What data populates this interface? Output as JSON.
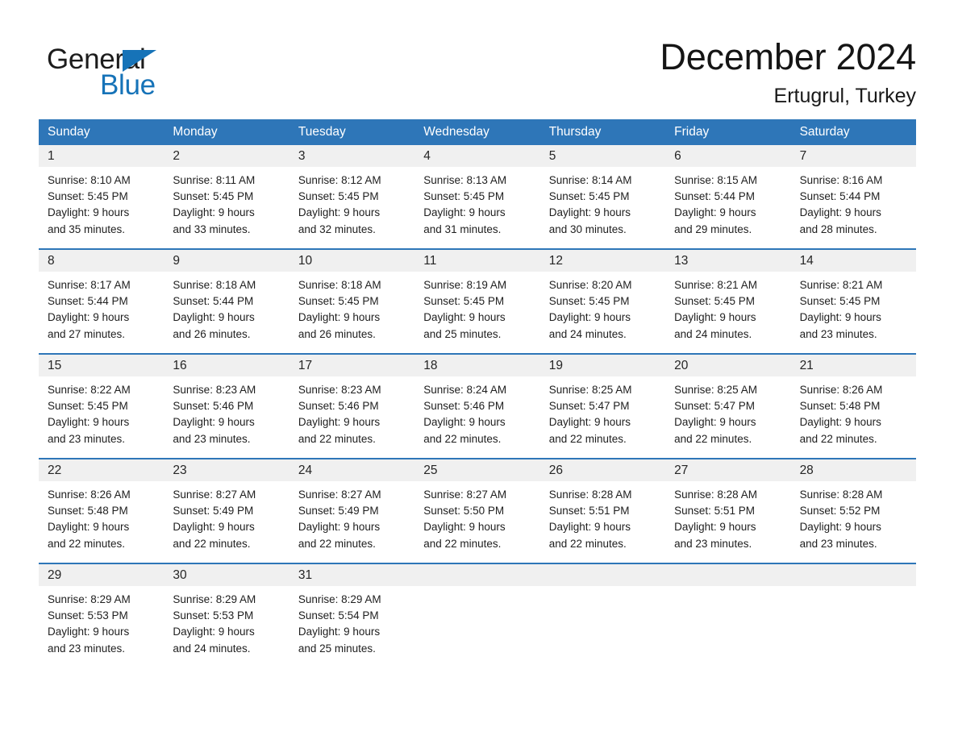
{
  "brand": {
    "word_one": "General",
    "word_two": "Blue",
    "triangle_icon": "triangle-icon",
    "accent_color": "#1673b8"
  },
  "header": {
    "month_title": "December 2024",
    "location": "Ertugrul, Turkey"
  },
  "theme": {
    "header_blue": "#2e76b8",
    "daynum_band": "#f0f0f0",
    "text": "#1e1e1e",
    "page_bg": "#ffffff"
  },
  "weekdays": [
    "Sunday",
    "Monday",
    "Tuesday",
    "Wednesday",
    "Thursday",
    "Friday",
    "Saturday"
  ],
  "weeks": [
    {
      "days": [
        {
          "num": "1",
          "sunrise": "Sunrise: 8:10 AM",
          "sunset": "Sunset: 5:45 PM",
          "daylight_l1": "Daylight: 9 hours",
          "daylight_l2": "and 35 minutes."
        },
        {
          "num": "2",
          "sunrise": "Sunrise: 8:11 AM",
          "sunset": "Sunset: 5:45 PM",
          "daylight_l1": "Daylight: 9 hours",
          "daylight_l2": "and 33 minutes."
        },
        {
          "num": "3",
          "sunrise": "Sunrise: 8:12 AM",
          "sunset": "Sunset: 5:45 PM",
          "daylight_l1": "Daylight: 9 hours",
          "daylight_l2": "and 32 minutes."
        },
        {
          "num": "4",
          "sunrise": "Sunrise: 8:13 AM",
          "sunset": "Sunset: 5:45 PM",
          "daylight_l1": "Daylight: 9 hours",
          "daylight_l2": "and 31 minutes."
        },
        {
          "num": "5",
          "sunrise": "Sunrise: 8:14 AM",
          "sunset": "Sunset: 5:45 PM",
          "daylight_l1": "Daylight: 9 hours",
          "daylight_l2": "and 30 minutes."
        },
        {
          "num": "6",
          "sunrise": "Sunrise: 8:15 AM",
          "sunset": "Sunset: 5:44 PM",
          "daylight_l1": "Daylight: 9 hours",
          "daylight_l2": "and 29 minutes."
        },
        {
          "num": "7",
          "sunrise": "Sunrise: 8:16 AM",
          "sunset": "Sunset: 5:44 PM",
          "daylight_l1": "Daylight: 9 hours",
          "daylight_l2": "and 28 minutes."
        }
      ]
    },
    {
      "days": [
        {
          "num": "8",
          "sunrise": "Sunrise: 8:17 AM",
          "sunset": "Sunset: 5:44 PM",
          "daylight_l1": "Daylight: 9 hours",
          "daylight_l2": "and 27 minutes."
        },
        {
          "num": "9",
          "sunrise": "Sunrise: 8:18 AM",
          "sunset": "Sunset: 5:44 PM",
          "daylight_l1": "Daylight: 9 hours",
          "daylight_l2": "and 26 minutes."
        },
        {
          "num": "10",
          "sunrise": "Sunrise: 8:18 AM",
          "sunset": "Sunset: 5:45 PM",
          "daylight_l1": "Daylight: 9 hours",
          "daylight_l2": "and 26 minutes."
        },
        {
          "num": "11",
          "sunrise": "Sunrise: 8:19 AM",
          "sunset": "Sunset: 5:45 PM",
          "daylight_l1": "Daylight: 9 hours",
          "daylight_l2": "and 25 minutes."
        },
        {
          "num": "12",
          "sunrise": "Sunrise: 8:20 AM",
          "sunset": "Sunset: 5:45 PM",
          "daylight_l1": "Daylight: 9 hours",
          "daylight_l2": "and 24 minutes."
        },
        {
          "num": "13",
          "sunrise": "Sunrise: 8:21 AM",
          "sunset": "Sunset: 5:45 PM",
          "daylight_l1": "Daylight: 9 hours",
          "daylight_l2": "and 24 minutes."
        },
        {
          "num": "14",
          "sunrise": "Sunrise: 8:21 AM",
          "sunset": "Sunset: 5:45 PM",
          "daylight_l1": "Daylight: 9 hours",
          "daylight_l2": "and 23 minutes."
        }
      ]
    },
    {
      "days": [
        {
          "num": "15",
          "sunrise": "Sunrise: 8:22 AM",
          "sunset": "Sunset: 5:45 PM",
          "daylight_l1": "Daylight: 9 hours",
          "daylight_l2": "and 23 minutes."
        },
        {
          "num": "16",
          "sunrise": "Sunrise: 8:23 AM",
          "sunset": "Sunset: 5:46 PM",
          "daylight_l1": "Daylight: 9 hours",
          "daylight_l2": "and 23 minutes."
        },
        {
          "num": "17",
          "sunrise": "Sunrise: 8:23 AM",
          "sunset": "Sunset: 5:46 PM",
          "daylight_l1": "Daylight: 9 hours",
          "daylight_l2": "and 22 minutes."
        },
        {
          "num": "18",
          "sunrise": "Sunrise: 8:24 AM",
          "sunset": "Sunset: 5:46 PM",
          "daylight_l1": "Daylight: 9 hours",
          "daylight_l2": "and 22 minutes."
        },
        {
          "num": "19",
          "sunrise": "Sunrise: 8:25 AM",
          "sunset": "Sunset: 5:47 PM",
          "daylight_l1": "Daylight: 9 hours",
          "daylight_l2": "and 22 minutes."
        },
        {
          "num": "20",
          "sunrise": "Sunrise: 8:25 AM",
          "sunset": "Sunset: 5:47 PM",
          "daylight_l1": "Daylight: 9 hours",
          "daylight_l2": "and 22 minutes."
        },
        {
          "num": "21",
          "sunrise": "Sunrise: 8:26 AM",
          "sunset": "Sunset: 5:48 PM",
          "daylight_l1": "Daylight: 9 hours",
          "daylight_l2": "and 22 minutes."
        }
      ]
    },
    {
      "days": [
        {
          "num": "22",
          "sunrise": "Sunrise: 8:26 AM",
          "sunset": "Sunset: 5:48 PM",
          "daylight_l1": "Daylight: 9 hours",
          "daylight_l2": "and 22 minutes."
        },
        {
          "num": "23",
          "sunrise": "Sunrise: 8:27 AM",
          "sunset": "Sunset: 5:49 PM",
          "daylight_l1": "Daylight: 9 hours",
          "daylight_l2": "and 22 minutes."
        },
        {
          "num": "24",
          "sunrise": "Sunrise: 8:27 AM",
          "sunset": "Sunset: 5:49 PM",
          "daylight_l1": "Daylight: 9 hours",
          "daylight_l2": "and 22 minutes."
        },
        {
          "num": "25",
          "sunrise": "Sunrise: 8:27 AM",
          "sunset": "Sunset: 5:50 PM",
          "daylight_l1": "Daylight: 9 hours",
          "daylight_l2": "and 22 minutes."
        },
        {
          "num": "26",
          "sunrise": "Sunrise: 8:28 AM",
          "sunset": "Sunset: 5:51 PM",
          "daylight_l1": "Daylight: 9 hours",
          "daylight_l2": "and 22 minutes."
        },
        {
          "num": "27",
          "sunrise": "Sunrise: 8:28 AM",
          "sunset": "Sunset: 5:51 PM",
          "daylight_l1": "Daylight: 9 hours",
          "daylight_l2": "and 23 minutes."
        },
        {
          "num": "28",
          "sunrise": "Sunrise: 8:28 AM",
          "sunset": "Sunset: 5:52 PM",
          "daylight_l1": "Daylight: 9 hours",
          "daylight_l2": "and 23 minutes."
        }
      ]
    },
    {
      "days": [
        {
          "num": "29",
          "sunrise": "Sunrise: 8:29 AM",
          "sunset": "Sunset: 5:53 PM",
          "daylight_l1": "Daylight: 9 hours",
          "daylight_l2": "and 23 minutes."
        },
        {
          "num": "30",
          "sunrise": "Sunrise: 8:29 AM",
          "sunset": "Sunset: 5:53 PM",
          "daylight_l1": "Daylight: 9 hours",
          "daylight_l2": "and 24 minutes."
        },
        {
          "num": "31",
          "sunrise": "Sunrise: 8:29 AM",
          "sunset": "Sunset: 5:54 PM",
          "daylight_l1": "Daylight: 9 hours",
          "daylight_l2": "and 25 minutes."
        },
        {
          "num": "",
          "sunrise": "",
          "sunset": "",
          "daylight_l1": "",
          "daylight_l2": ""
        },
        {
          "num": "",
          "sunrise": "",
          "sunset": "",
          "daylight_l1": "",
          "daylight_l2": ""
        },
        {
          "num": "",
          "sunrise": "",
          "sunset": "",
          "daylight_l1": "",
          "daylight_l2": ""
        },
        {
          "num": "",
          "sunrise": "",
          "sunset": "",
          "daylight_l1": "",
          "daylight_l2": ""
        }
      ]
    }
  ]
}
